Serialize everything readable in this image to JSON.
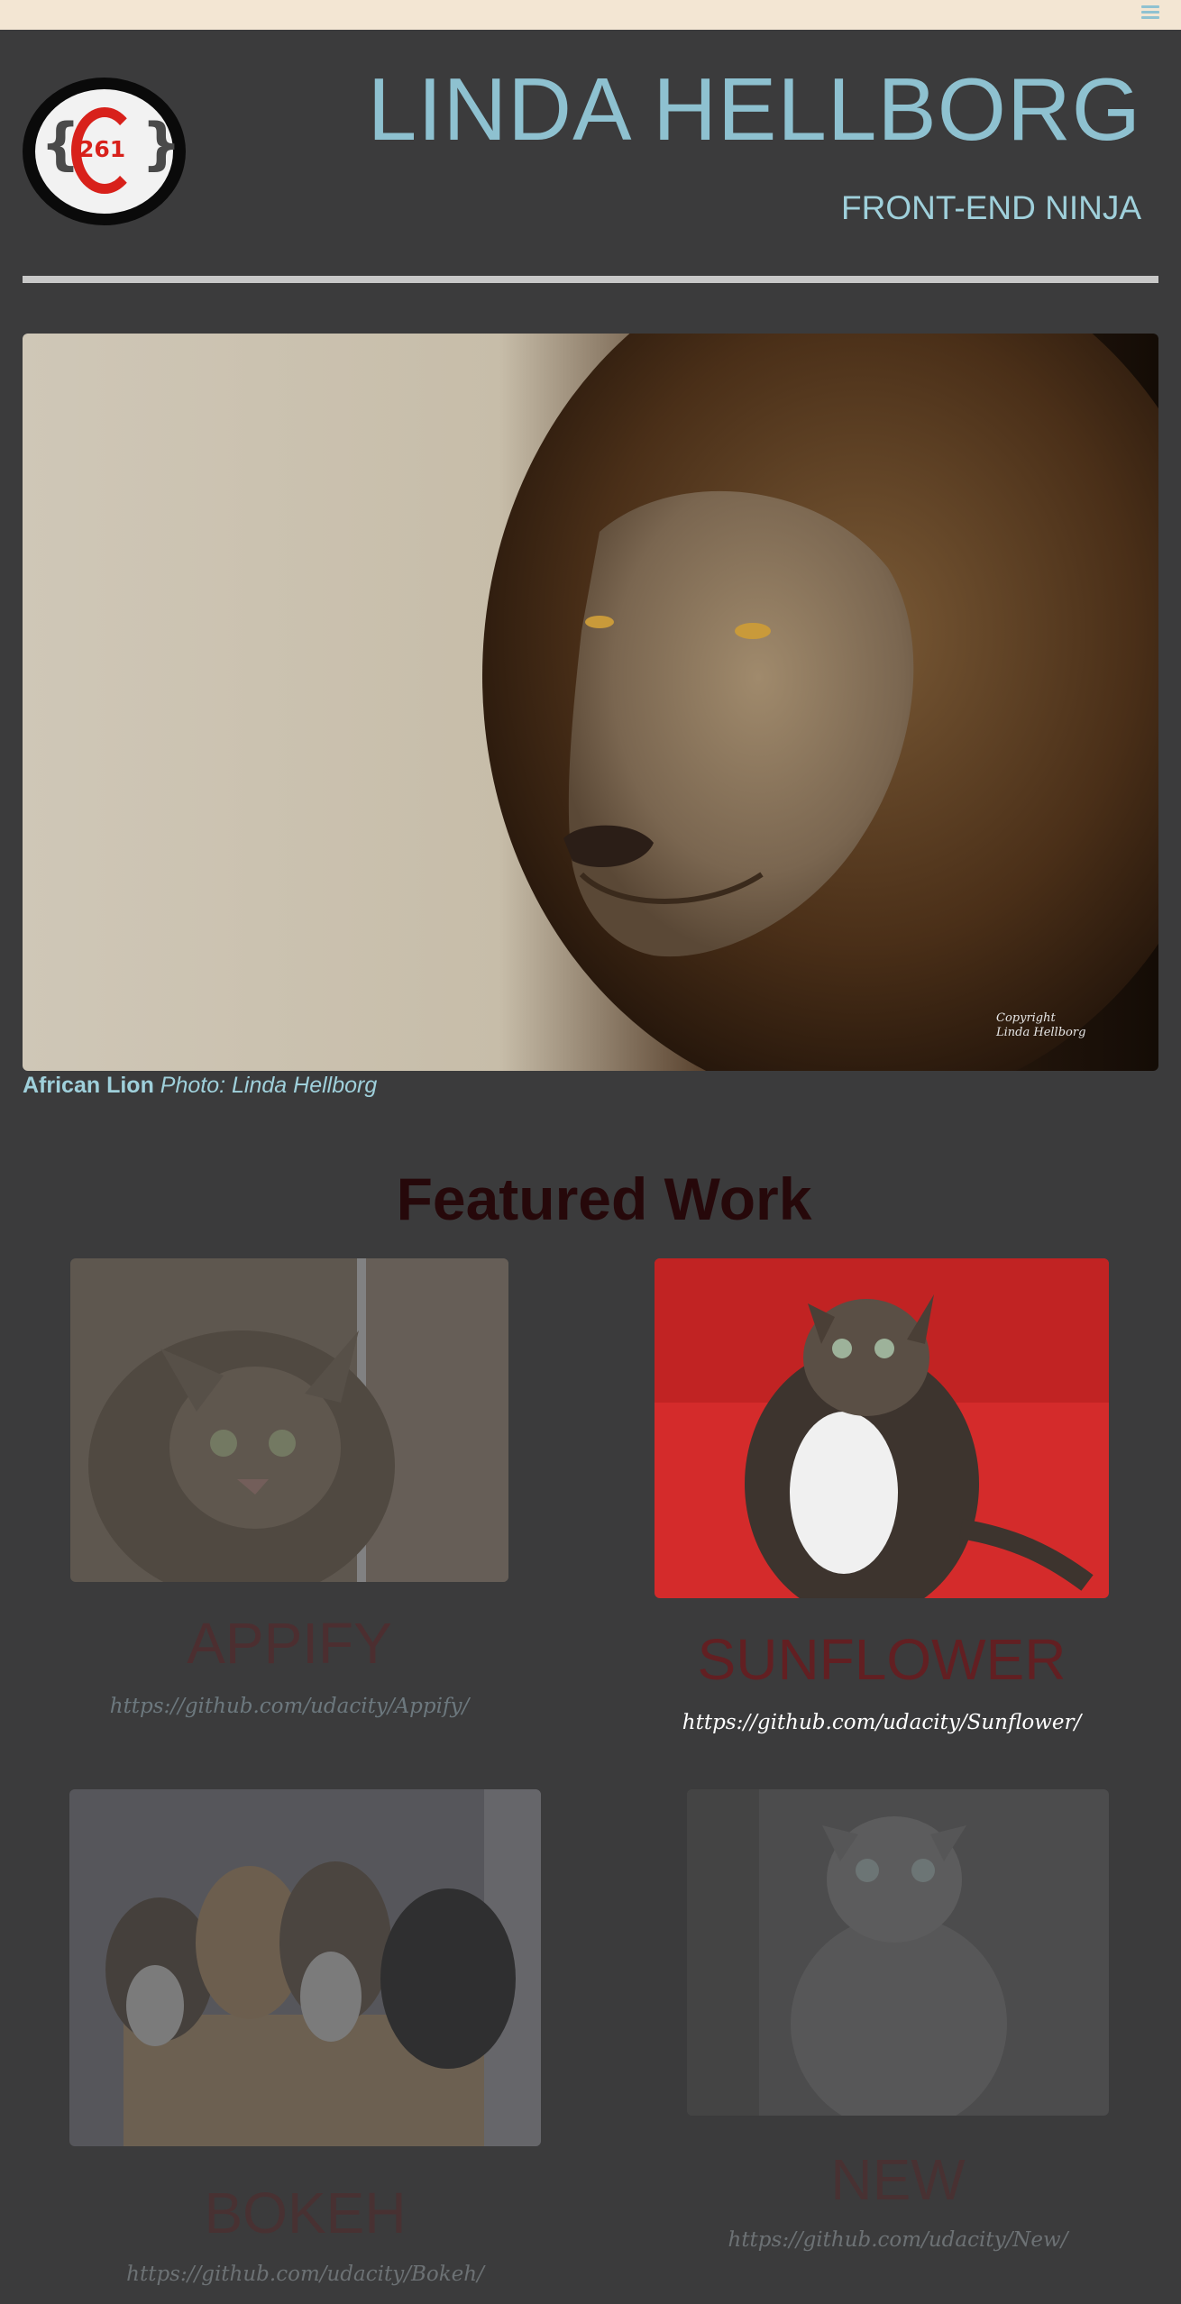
{
  "topbar": {
    "menu_icon": "hamburger-menu-icon",
    "background": "#f3e6d3"
  },
  "logo": {
    "number": "261",
    "left_brace": "{",
    "right_brace": "}"
  },
  "header": {
    "title": "LINDA HELLBORG",
    "subtitle": "FRONT-END NINJA"
  },
  "hero": {
    "watermark_line1": "Copyright",
    "watermark_line2": "Linda Hellborg",
    "caption_title": "African Lion",
    "caption_credit": "Photo: Linda Hellborg"
  },
  "featured": {
    "heading": "Featured Work",
    "projects": [
      {
        "title": "APPIFY",
        "url": "https://github.com/udacity/Appify/"
      },
      {
        "title": "SUNFLOWER",
        "url": "https://github.com/udacity/Sunflower/"
      },
      {
        "title": "BOKEH",
        "url": "https://github.com/udacity/Bokeh/"
      },
      {
        "title": "NEW",
        "url": "https://github.com/udacity/New/"
      }
    ]
  },
  "colors": {
    "accent": "#8ec1d0",
    "background": "#3b3b3c",
    "project_title": "#621f22",
    "heading": "#26080a"
  }
}
